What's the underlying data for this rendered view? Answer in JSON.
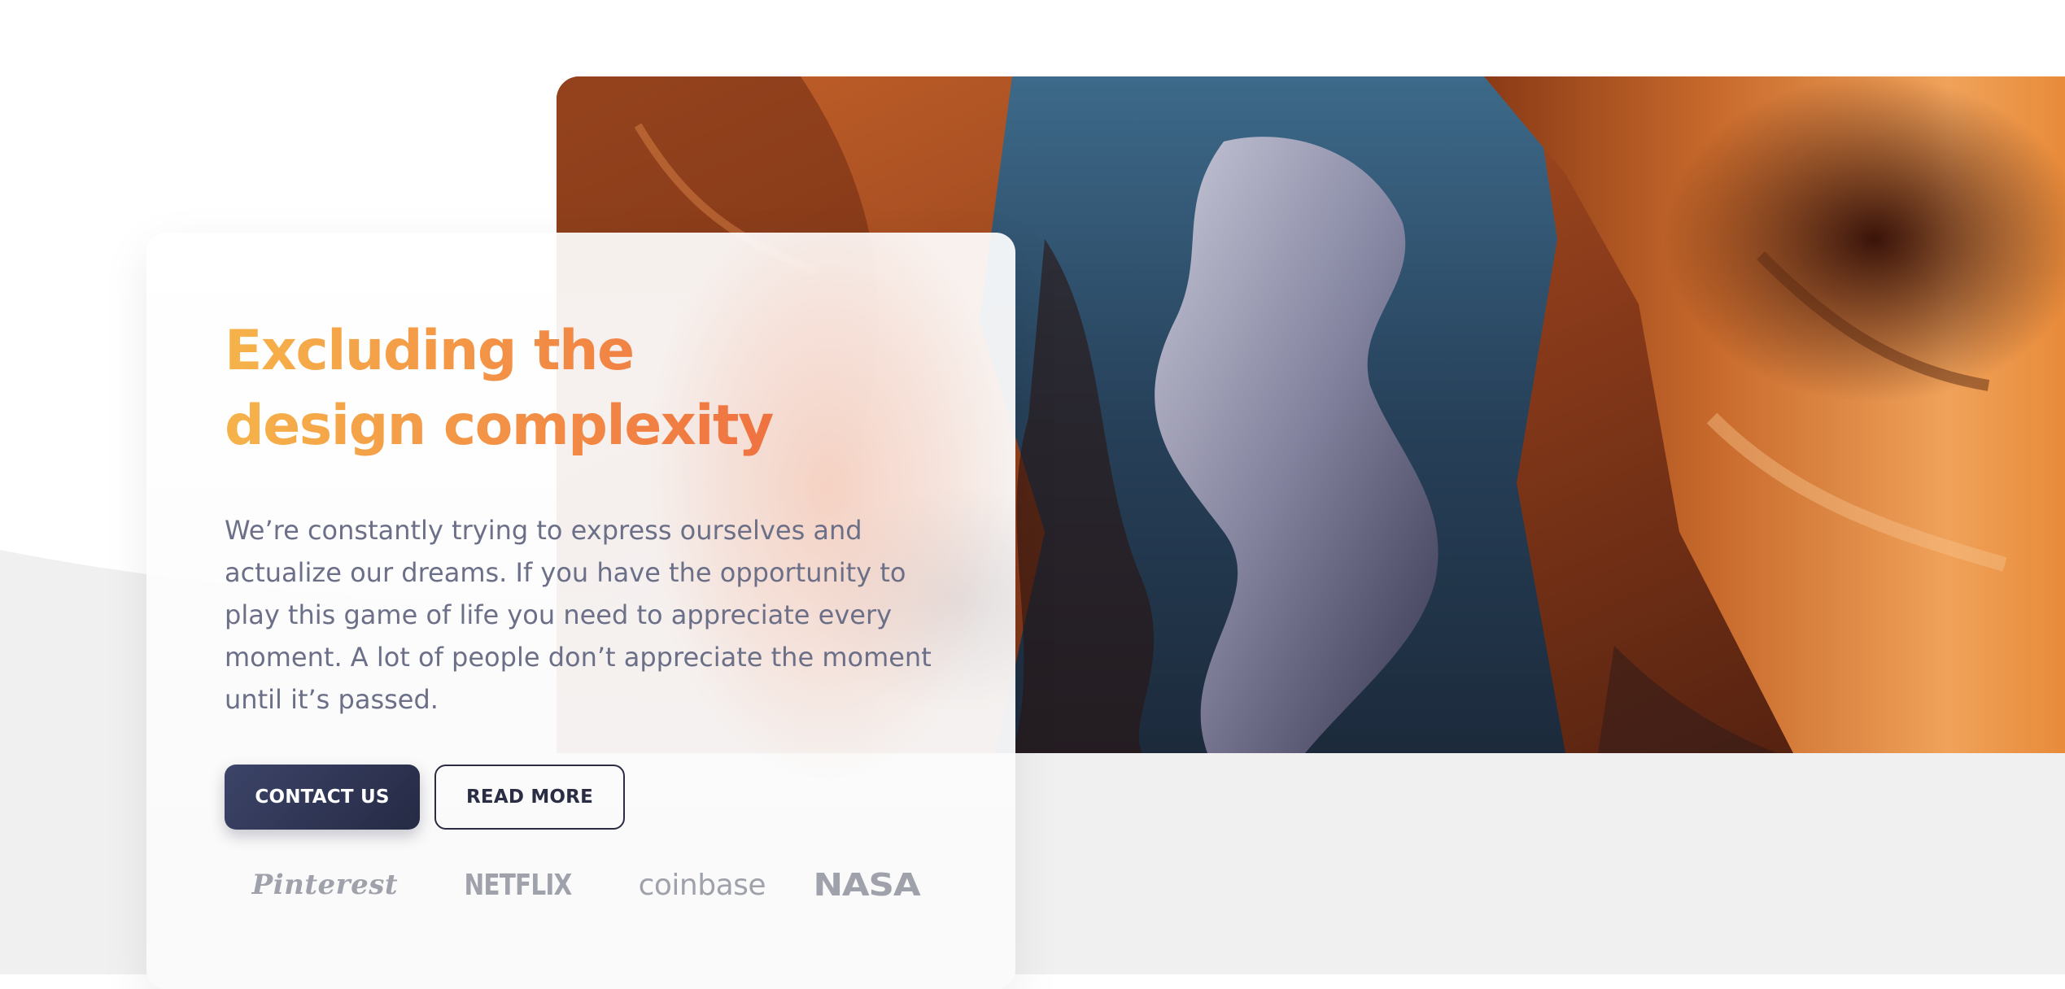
{
  "hero": {
    "title": "Excluding the design complexity",
    "description": "We’re constantly trying to express ourselves and actualize our dreams. If you have the opportunity to play this game of life you need to appreciate every moment. A lot of people don’t appreciate the moment until it’s passed.",
    "image_alt": "canyon-photo",
    "buttons": {
      "primary_label": "CONTACT US",
      "secondary_label": "READ MORE"
    }
  },
  "logos": [
    {
      "name": "Pinterest"
    },
    {
      "name": "NETFLIX"
    },
    {
      "name": "coinbase"
    },
    {
      "name": "NASA"
    }
  ],
  "colors": {
    "title_gradient_start": "#f6b34a",
    "title_gradient_end": "#ee6a3f",
    "primary_button": "#2f3553",
    "body_text": "#6b6f87",
    "logo_gray": "#9fa2ab",
    "page_gray": "#f0f0f0"
  }
}
